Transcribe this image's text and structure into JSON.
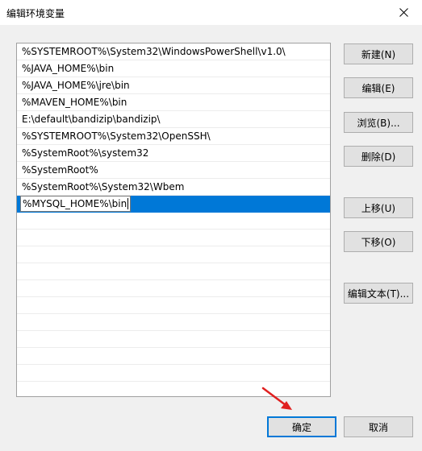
{
  "window": {
    "title": "编辑环境变量",
    "close_glyph": "close-icon"
  },
  "paths": [
    "%SYSTEMROOT%\\System32\\WindowsPowerShell\\v1.0\\",
    "%JAVA_HOME%\\bin",
    "%JAVA_HOME%\\jre\\bin",
    "%MAVEN_HOME%\\bin",
    "E:\\default\\bandizip\\bandizip\\",
    "%SYSTEMROOT%\\System32\\OpenSSH\\",
    "%SystemRoot%\\system32",
    "%SystemRoot%",
    "%SystemRoot%\\System32\\Wbem"
  ],
  "editing_value": "%MYSQL_HOME%\\bin",
  "buttons": {
    "new": "新建(N)",
    "edit": "编辑(E)",
    "browse": "浏览(B)...",
    "delete": "删除(D)",
    "move_up": "上移(U)",
    "move_down": "下移(O)",
    "edit_text": "编辑文本(T)...",
    "ok": "确定",
    "cancel": "取消"
  },
  "colors": {
    "selection": "#0078d7",
    "arrow": "#e02020"
  }
}
